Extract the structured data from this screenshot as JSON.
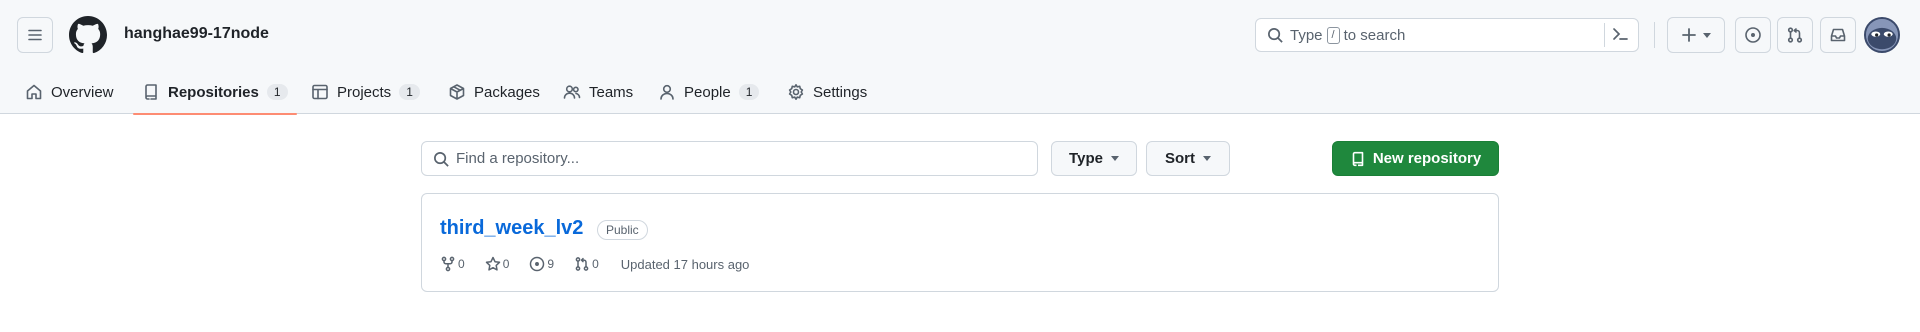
{
  "header": {
    "org_name": "hanghae99-17node",
    "search": {
      "prefix": "Type",
      "key": "/",
      "suffix": "to search"
    }
  },
  "nav": {
    "tabs": [
      {
        "label": "Overview",
        "icon": "home-icon"
      },
      {
        "label": "Repositories",
        "icon": "repo-icon",
        "count": "1",
        "active": true
      },
      {
        "label": "Projects",
        "icon": "table-icon",
        "count": "1"
      },
      {
        "label": "Packages",
        "icon": "package-icon"
      },
      {
        "label": "Teams",
        "icon": "people-icon"
      },
      {
        "label": "People",
        "icon": "person-icon",
        "count": "1"
      },
      {
        "label": "Settings",
        "icon": "gear-icon"
      }
    ]
  },
  "main": {
    "find_placeholder": "Find a repository...",
    "type_label": "Type",
    "sort_label": "Sort",
    "new_repo_label": "New repository",
    "repositories": [
      {
        "name": "third_week_lv2",
        "visibility": "Public",
        "forks": "0",
        "stars": "0",
        "issues": "9",
        "pulls": "0",
        "updated": "Updated 17 hours ago"
      }
    ]
  },
  "colors": {
    "accent_green": "#1f883d",
    "link_blue": "#0969da",
    "tab_underline": "#fd8c73"
  }
}
